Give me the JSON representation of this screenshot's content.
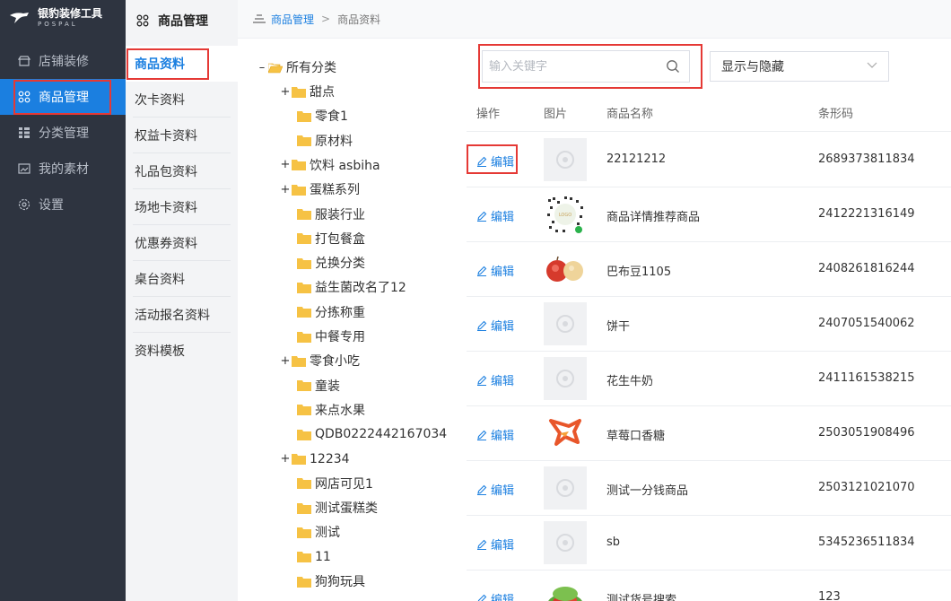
{
  "app": {
    "logo_text": "银豹装修工具",
    "logo_sub": "POSPAL"
  },
  "nav": {
    "items": [
      {
        "label": "店铺装修",
        "icon": "store-icon"
      },
      {
        "label": "商品管理",
        "icon": "grid-icon",
        "active": true
      },
      {
        "label": "分类管理",
        "icon": "category-list-icon"
      },
      {
        "label": "我的素材",
        "icon": "image-icon"
      },
      {
        "label": "设置",
        "icon": "gear-icon"
      }
    ]
  },
  "sub": {
    "title": "商品管理",
    "items": [
      {
        "label": "商品资料",
        "active": true
      },
      {
        "label": "次卡资料"
      },
      {
        "label": "权益卡资料"
      },
      {
        "label": "礼品包资料"
      },
      {
        "label": "场地卡资料"
      },
      {
        "label": "优惠券资料"
      },
      {
        "label": "桌台资料"
      },
      {
        "label": "活动报名资料"
      },
      {
        "label": "资料模板"
      }
    ]
  },
  "breadcrumb": {
    "parent": "商品管理",
    "separator": ">",
    "current": "商品资料"
  },
  "tree": {
    "root": "所有分类",
    "nodes": [
      {
        "label": "甜点",
        "toggle": "+",
        "level": 1
      },
      {
        "label": "零食1",
        "toggle": "",
        "level": 2
      },
      {
        "label": "原材料",
        "toggle": "",
        "level": 2
      },
      {
        "label": "饮料 asbiha",
        "toggle": "+",
        "level": 1
      },
      {
        "label": "蛋糕系列",
        "toggle": "+",
        "level": 1
      },
      {
        "label": "服装行业",
        "toggle": "",
        "level": 2
      },
      {
        "label": "打包餐盒",
        "toggle": "",
        "level": 2
      },
      {
        "label": "兑换分类",
        "toggle": "",
        "level": 2
      },
      {
        "label": "益生菌改名了12",
        "toggle": "",
        "level": 2
      },
      {
        "label": "分拣称重",
        "toggle": "",
        "level": 2
      },
      {
        "label": "中餐专用",
        "toggle": "",
        "level": 2
      },
      {
        "label": "零食小吃",
        "toggle": "+",
        "level": 1
      },
      {
        "label": "童装",
        "toggle": "",
        "level": 2
      },
      {
        "label": "来点水果",
        "toggle": "",
        "level": 2
      },
      {
        "label": "QDB0222442167034",
        "toggle": "",
        "level": 2
      },
      {
        "label": "12234",
        "toggle": "+",
        "level": 1
      },
      {
        "label": "网店可见1",
        "toggle": "",
        "level": 2
      },
      {
        "label": "测试蛋糕类",
        "toggle": "",
        "level": 2
      },
      {
        "label": "测试",
        "toggle": "",
        "level": 2
      },
      {
        "label": "11",
        "toggle": "",
        "level": 2
      },
      {
        "label": "狗狗玩具",
        "toggle": "",
        "level": 2
      }
    ]
  },
  "search": {
    "placeholder": "输入关键字",
    "value": ""
  },
  "visibility_select": {
    "value": "显示与隐藏"
  },
  "table": {
    "headers": {
      "action": "操作",
      "image": "图片",
      "name": "商品名称",
      "barcode": "条形码"
    },
    "edit_label": "编辑",
    "rows": [
      {
        "name": "22121212",
        "barcode": "2689373811834",
        "image": "placeholder"
      },
      {
        "name": "商品详情推荐商品",
        "barcode": "2412221316149",
        "image": "qr-code"
      },
      {
        "name": "巴布豆1105",
        "barcode": "2408261816244",
        "image": "apple-pear"
      },
      {
        "name": "饼干",
        "barcode": "2407051540062",
        "image": "placeholder"
      },
      {
        "name": "花生牛奶",
        "barcode": "2411161538215",
        "image": "placeholder"
      },
      {
        "name": "草莓口香糖",
        "barcode": "2503051908496",
        "image": "fox-logo"
      },
      {
        "name": "测试一分钱商品",
        "barcode": "2503121021070",
        "image": "placeholder"
      },
      {
        "name": "sb",
        "barcode": "5345236511834",
        "image": "placeholder"
      },
      {
        "name": "测试货号搜索",
        "barcode": "123",
        "image": "vegetables"
      }
    ]
  },
  "colors": {
    "sidebar_bg": "#2e3440",
    "accent": "#1b7fe0",
    "highlight": "#e53935"
  }
}
